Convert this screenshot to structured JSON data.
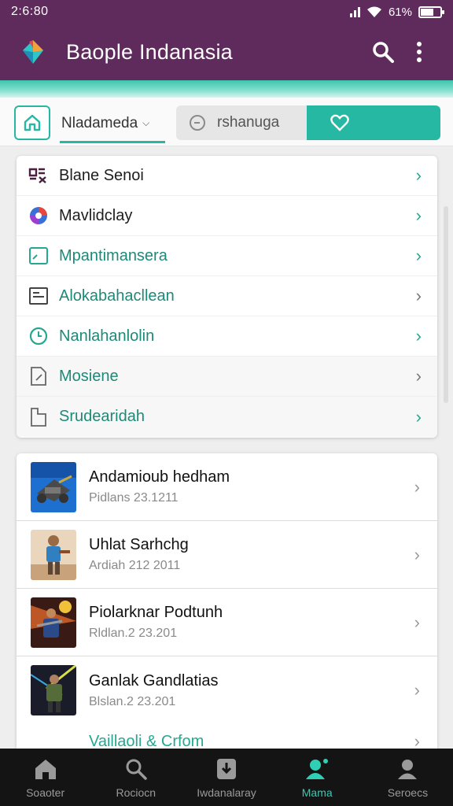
{
  "status_bar": {
    "time": "2:6:80",
    "battery": "61%",
    "battery_level": 0.61
  },
  "app_bar": {
    "title": "Baople Indanasia",
    "logo_icon": "app-logo-icon",
    "actions": [
      "search-icon",
      "more-vert-icon"
    ]
  },
  "filters": {
    "dropdown_label": "Nladameda",
    "search_value": "rshanuga",
    "accent": "#26b8a2"
  },
  "categories": [
    {
      "label": "Blane Senoi",
      "icon": "grid-sparkle-icon"
    },
    {
      "label": "Mavlidclay",
      "icon": "colorful-circle-icon"
    },
    {
      "label": "Mpantimansera",
      "icon": "chart-icon"
    },
    {
      "label": "Alokabahacllean",
      "icon": "list-box-icon"
    },
    {
      "label": "Nanlahanlolin",
      "icon": "clock-circle-icon"
    },
    {
      "label": "Mosiene",
      "icon": "document-icon"
    },
    {
      "label": "Srudearidah",
      "icon": "file-icon"
    }
  ],
  "apps": [
    {
      "name": "Andamioub hedham",
      "meta": "Pidlans 23.1211"
    },
    {
      "name": "Uhlat Sarhchg",
      "meta": "Ardiah 212 2011"
    },
    {
      "name": "Piolarknar Podtunh",
      "meta": "Rldlan.2 23.201"
    },
    {
      "name": "Ganlak Gandlatias",
      "meta": "Blslan.2 23.201"
    }
  ],
  "more_link": "Vaillaoli & Crfom",
  "nav": [
    {
      "label": "Soaoter",
      "icon": "home-icon",
      "active": false
    },
    {
      "label": "Rociocn",
      "icon": "search-icon",
      "active": false
    },
    {
      "label": "Iwdanalaray",
      "icon": "download-icon",
      "active": false
    },
    {
      "label": "Mama",
      "icon": "profile-badge-icon",
      "active": true
    },
    {
      "label": "Seroecs",
      "icon": "person-icon",
      "active": false
    }
  ]
}
